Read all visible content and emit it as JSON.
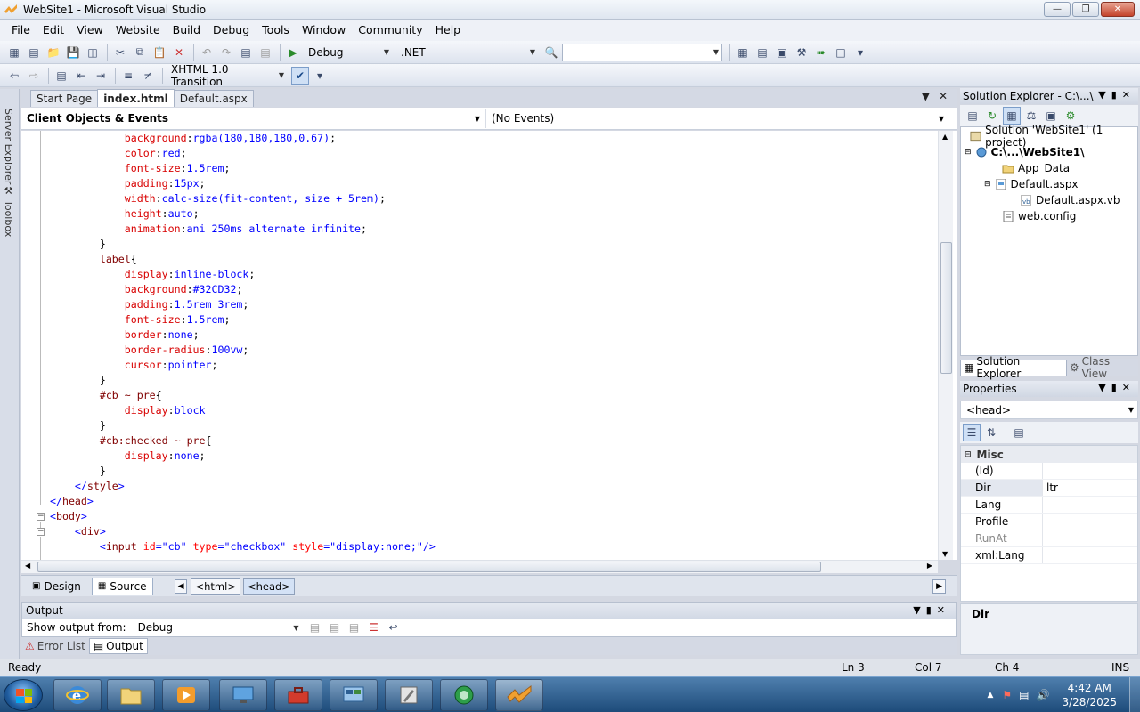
{
  "window": {
    "title": "WebSite1 - Microsoft Visual Studio"
  },
  "menu": [
    "File",
    "Edit",
    "View",
    "Website",
    "Build",
    "Debug",
    "Tools",
    "Window",
    "Community",
    "Help"
  ],
  "toolbar": {
    "config": "Debug",
    "platform": ".NET",
    "search_value": "",
    "doctype": "XHTML 1.0 Transition"
  },
  "left_strip": {
    "server_explorer": "Server Explorer",
    "toolbox": "Toolbox"
  },
  "doc_tabs": [
    {
      "label": "Start Page",
      "active": false
    },
    {
      "label": "index.html",
      "active": true
    },
    {
      "label": "Default.aspx",
      "active": false
    }
  ],
  "nav": {
    "objects": "Client Objects & Events",
    "events": "(No Events)"
  },
  "code_lines": [
    [
      [
        "",
        "            "
      ],
      [
        "prop",
        "background"
      ],
      [
        "",
        ":"
      ],
      [
        "val",
        "rgba(180,180,180,0.67)"
      ],
      [
        "",
        ";"
      ]
    ],
    [
      [
        "",
        "            "
      ],
      [
        "prop",
        "color"
      ],
      [
        "",
        ":"
      ],
      [
        "val",
        "red"
      ],
      [
        "",
        ";"
      ]
    ],
    [
      [
        "",
        "            "
      ],
      [
        "prop",
        "font-size"
      ],
      [
        "",
        ":"
      ],
      [
        "val",
        "1.5rem"
      ],
      [
        "",
        ";"
      ]
    ],
    [
      [
        "",
        "            "
      ],
      [
        "prop",
        "padding"
      ],
      [
        "",
        ":"
      ],
      [
        "val",
        "15px"
      ],
      [
        "",
        ";"
      ]
    ],
    [
      [
        "",
        "            "
      ],
      [
        "prop",
        "width"
      ],
      [
        "",
        ":"
      ],
      [
        "val",
        "calc-size(fit-content, size + 5rem)"
      ],
      [
        "",
        ";"
      ]
    ],
    [
      [
        "",
        "            "
      ],
      [
        "prop",
        "height"
      ],
      [
        "",
        ":"
      ],
      [
        "val",
        "auto"
      ],
      [
        "",
        ";"
      ]
    ],
    [
      [
        "",
        "            "
      ],
      [
        "prop",
        "animation"
      ],
      [
        "",
        ":"
      ],
      [
        "val",
        "ani 250ms alternate infinite"
      ],
      [
        "",
        ";"
      ]
    ],
    [
      [
        "",
        "        }"
      ]
    ],
    [
      [
        "",
        "        "
      ],
      [
        "sel",
        "label"
      ],
      [
        "",
        "{"
      ]
    ],
    [
      [
        "",
        "            "
      ],
      [
        "prop",
        "display"
      ],
      [
        "",
        ":"
      ],
      [
        "val",
        "inline-block"
      ],
      [
        "",
        ";"
      ]
    ],
    [
      [
        "",
        "            "
      ],
      [
        "prop",
        "background"
      ],
      [
        "",
        ":"
      ],
      [
        "val",
        "#32CD32"
      ],
      [
        "",
        ";"
      ]
    ],
    [
      [
        "",
        "            "
      ],
      [
        "prop",
        "padding"
      ],
      [
        "",
        ":"
      ],
      [
        "val",
        "1.5rem 3rem"
      ],
      [
        "",
        ";"
      ]
    ],
    [
      [
        "",
        "            "
      ],
      [
        "prop",
        "font-size"
      ],
      [
        "",
        ":"
      ],
      [
        "val",
        "1.5rem"
      ],
      [
        "",
        ";"
      ]
    ],
    [
      [
        "",
        "            "
      ],
      [
        "prop",
        "border"
      ],
      [
        "",
        ":"
      ],
      [
        "val",
        "none"
      ],
      [
        "",
        ";"
      ]
    ],
    [
      [
        "",
        "            "
      ],
      [
        "prop",
        "border-radius"
      ],
      [
        "",
        ":"
      ],
      [
        "val",
        "100vw"
      ],
      [
        "",
        ";"
      ]
    ],
    [
      [
        "",
        "            "
      ],
      [
        "prop",
        "cursor"
      ],
      [
        "",
        ":"
      ],
      [
        "val",
        "pointer"
      ],
      [
        "",
        ";"
      ]
    ],
    [
      [
        "",
        "        }"
      ]
    ],
    [
      [
        "",
        "        "
      ],
      [
        "sel",
        "#cb ~ pre"
      ],
      [
        "",
        "{"
      ]
    ],
    [
      [
        "",
        "            "
      ],
      [
        "prop",
        "display"
      ],
      [
        "",
        ":"
      ],
      [
        "val",
        "block"
      ]
    ],
    [
      [
        "",
        "        }"
      ]
    ],
    [
      [
        "",
        "        "
      ],
      [
        "sel",
        "#cb:checked ~ pre"
      ],
      [
        "",
        "{"
      ]
    ],
    [
      [
        "",
        "            "
      ],
      [
        "prop",
        "display"
      ],
      [
        "",
        ":"
      ],
      [
        "val",
        "none"
      ],
      [
        "",
        ";"
      ]
    ],
    [
      [
        "",
        "        }"
      ]
    ],
    [
      [
        "",
        "    "
      ],
      [
        "br",
        "</"
      ],
      [
        "tag",
        "style"
      ],
      [
        "br",
        ">"
      ]
    ],
    [
      [
        "",
        ""
      ],
      [
        "br",
        "</"
      ],
      [
        "tag",
        "head"
      ],
      [
        "br",
        ">"
      ]
    ],
    [
      [
        "",
        ""
      ],
      [
        "br",
        "<"
      ],
      [
        "tag",
        "body"
      ],
      [
        "br",
        ">"
      ]
    ],
    [
      [
        "",
        "    "
      ],
      [
        "br",
        "<"
      ],
      [
        "tag",
        "div"
      ],
      [
        "br",
        ">"
      ]
    ],
    [
      [
        "",
        "        "
      ],
      [
        "br",
        "<"
      ],
      [
        "tag",
        "input"
      ],
      [
        "",
        " "
      ],
      [
        "attr",
        "id"
      ],
      [
        "br",
        "="
      ],
      [
        "str",
        "\"cb\""
      ],
      [
        "",
        " "
      ],
      [
        "attr",
        "type"
      ],
      [
        "br",
        "="
      ],
      [
        "str",
        "\"checkbox\""
      ],
      [
        "",
        " "
      ],
      [
        "attr",
        "style"
      ],
      [
        "br",
        "="
      ],
      [
        "str",
        "\"display:none;\""
      ],
      [
        "br",
        "/>"
      ]
    ]
  ],
  "editor_bar": {
    "design": "Design",
    "source": "Source",
    "crumbs": [
      "<html>",
      "<head>"
    ]
  },
  "output": {
    "title": "Output",
    "show_from_label": "Show output from:",
    "show_from_value": "Debug",
    "tabs": [
      {
        "label": "Error List",
        "active": false
      },
      {
        "label": "Output",
        "active": true
      }
    ]
  },
  "solution_explorer": {
    "title": "Solution Explorer - C:\\...\\",
    "tree": [
      {
        "label": "Solution 'WebSite1' (1 project)",
        "bold": false
      },
      {
        "label": "C:\\...\\WebSite1\\",
        "bold": true
      },
      {
        "label": "App_Data",
        "bold": false
      },
      {
        "label": "Default.aspx",
        "bold": false
      },
      {
        "label": "Default.aspx.vb",
        "bold": false
      },
      {
        "label": "web.config",
        "bold": false
      }
    ],
    "tabs": [
      {
        "label": "Solution Explorer",
        "active": true
      },
      {
        "label": "Class View",
        "active": false
      }
    ]
  },
  "properties": {
    "title": "Properties",
    "object": "<head>",
    "category": "Misc",
    "rows": [
      {
        "name": "(Id)",
        "value": ""
      },
      {
        "name": "Dir",
        "value": "ltr"
      },
      {
        "name": "Lang",
        "value": ""
      },
      {
        "name": "Profile",
        "value": ""
      },
      {
        "name": "RunAt",
        "value": ""
      },
      {
        "name": "xml:Lang",
        "value": ""
      }
    ],
    "description": "Dir"
  },
  "status": {
    "text": "Ready",
    "ln": "Ln 3",
    "col": "Col 7",
    "ch": "Ch 4",
    "mode": "INS"
  },
  "taskbar": {
    "time": "4:42 AM",
    "date": "3/28/2025"
  }
}
